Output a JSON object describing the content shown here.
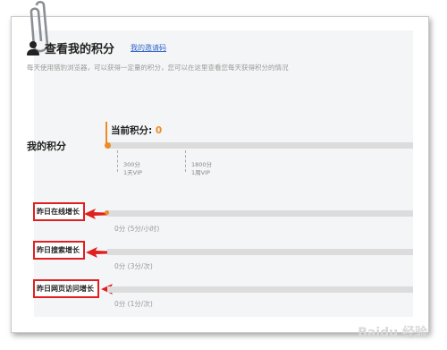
{
  "header": {
    "title": "查看我的积分",
    "invite_link": "我的邀请码",
    "description": "每天使用猎豹浏览器，可以获得一定量的积分，您可以在这里查看您每天获得积分的情况"
  },
  "points": {
    "section_label": "我的积分",
    "current_label": "当前积分:",
    "current_value": "0",
    "progress_fraction": 0,
    "milestones": [
      {
        "points": "300分",
        "reward": "1天VIP"
      },
      {
        "points": "1800分",
        "reward": "1周VIP"
      }
    ]
  },
  "rows": [
    {
      "label": "昨日在线增长",
      "value": "0分 (5分/小时)"
    },
    {
      "label": "昨日搜索增长",
      "value": "0分 (3分/次)"
    },
    {
      "label": "昨日网页访问增长",
      "value": "0分 (1分/次)"
    }
  ],
  "watermark": "Baidu 经验",
  "colors": {
    "accent": "#f08a24",
    "highlight": "#e02020",
    "link": "#3366cc"
  }
}
